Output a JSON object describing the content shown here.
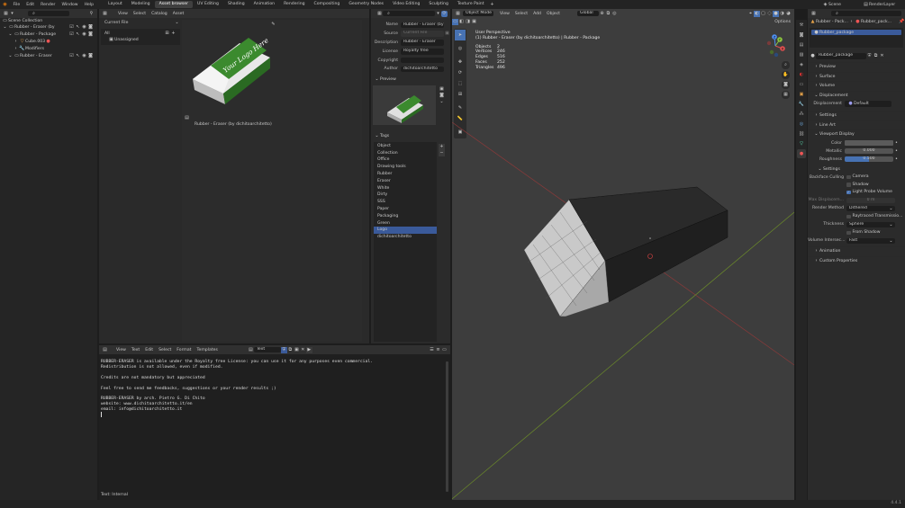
{
  "topbar": {
    "menus": [
      "File",
      "Edit",
      "Render",
      "Window",
      "Help"
    ],
    "workspaces": [
      {
        "label": "Layout"
      },
      {
        "label": "Modeling"
      },
      {
        "label": "Asset browser",
        "active": true
      },
      {
        "label": "UV Editing"
      },
      {
        "label": "Shading"
      },
      {
        "label": "Animation"
      },
      {
        "label": "Rendering"
      },
      {
        "label": "Compositing"
      },
      {
        "label": "Geometry Nodes"
      },
      {
        "label": "Video Editing"
      },
      {
        "label": "Sculpting"
      },
      {
        "label": "Texture Paint"
      }
    ],
    "scene": "Scene",
    "view_layer": "RenderLayer"
  },
  "outliner": {
    "search_placeholder": "",
    "root": "Scene Collection",
    "items": [
      {
        "label": "Rubber - Eraser (by",
        "depth": 0
      },
      {
        "label": "Rubber - Package",
        "depth": 1
      },
      {
        "label": "Cube.003",
        "depth": 2
      },
      {
        "label": "Modifiers",
        "depth": 2
      },
      {
        "label": "Rubber - Eraser",
        "depth": 1
      }
    ]
  },
  "asset_browser": {
    "menus": [
      "View",
      "Select",
      "Catalog",
      "Asset"
    ],
    "library": "Current File",
    "catalogs": [
      "All",
      "Unassigned"
    ],
    "asset_caption": "Rubber - Eraser (by dichitoarchitetto)",
    "thumb_text": "Your Logo Here"
  },
  "asset_meta": {
    "fields": [
      {
        "label": "Name",
        "value": "Rubber - Eraser (by"
      },
      {
        "label": "Source",
        "value": "Current File"
      },
      {
        "label": "Description",
        "value": "Rubber - Eraser"
      },
      {
        "label": "License",
        "value": "Royalty free"
      },
      {
        "label": "Copyright",
        "value": ""
      },
      {
        "label": "Author",
        "value": "dichitoarchitetto"
      }
    ],
    "preview_title": "Preview",
    "tags_title": "Tags",
    "tags": [
      "Object",
      "Collection",
      "Office",
      "Drawing tools",
      "Rubber",
      "Eraser",
      "White",
      "Dirty",
      "SSS",
      "Paper",
      "Packaging",
      "Green",
      "Logo",
      "dichitoarchitetto"
    ],
    "selected_tag": "Logo"
  },
  "text_editor": {
    "menus": [
      "View",
      "Text",
      "Edit",
      "Select",
      "Format",
      "Templates"
    ],
    "filename": "Text",
    "lines": [
      "RUBBER-ERASER is available under the Royalty free License: you can use it for any purposes even commercial.",
      "Redistribution is not allowed, even if modified.",
      "",
      "Credits are not mandatory but appreciated",
      "",
      "Feel free to send me feedbacks, suggestions or your render results ;)",
      "",
      "RUBBER-ERASER by arch. Pietro G. Di Chito",
      "website: www.dichitoarchitetto.it/en",
      "email: info@dichitoarchitetto.it"
    ],
    "status": "Text: Internal"
  },
  "viewport": {
    "mode": "Object Mode",
    "menus": [
      "View",
      "Select",
      "Add",
      "Object"
    ],
    "orientation": "Global",
    "options": "Options",
    "perspective": "User Perspective",
    "collection_path": "(1) Rubber - Eraser (by dichitoarchitetto) | Rubber - Package",
    "stats": [
      {
        "k": "Objects",
        "v": "2"
      },
      {
        "k": "Vertices",
        "v": "246"
      },
      {
        "k": "Edges",
        "v": "516"
      },
      {
        "k": "Faces",
        "v": "252"
      },
      {
        "k": "Triangles",
        "v": "496"
      }
    ],
    "axes": [
      "X",
      "Y",
      "Z"
    ]
  },
  "properties": {
    "breadcrumb_obj": "Rubber - Pack...",
    "breadcrumb_data": "Rubber_pack...",
    "data_list_item": "Rubber_package",
    "datablock": "Rubber_package",
    "sections": [
      "Preview",
      "Surface",
      "Volume"
    ],
    "displacement": {
      "title": "Displacement",
      "label": "Displacement",
      "value": "Default"
    },
    "settings": "Settings",
    "line_art": "Line Art",
    "viewport_display": {
      "title": "Viewport Display",
      "color_label": "Color",
      "metallic_label": "Metallic",
      "metallic": "0.000",
      "roughness_label": "Roughness",
      "roughness": "0.500",
      "roughness_frac": 0.5
    },
    "sub_settings": "Settings",
    "backface_label": "Backface Culling",
    "checks": [
      {
        "label": "Camera",
        "on": false
      },
      {
        "label": "Shadow",
        "on": false
      },
      {
        "label": "Light Probe Volume",
        "on": true
      }
    ],
    "max_disp_label": "Max Displacem...",
    "max_disp_val": "0 m",
    "render_method_label": "Render Method",
    "render_method": "Dithered",
    "raytraced": "Raytraced Transmissio...",
    "thickness_label": "Thickness",
    "thickness": "Sphere",
    "from_shadow": "From Shadow",
    "volume_label": "Volume Intersec...",
    "volume": "Fast",
    "bottom_sections": [
      "Animation",
      "Custom Properties"
    ]
  },
  "statusbar": {
    "version": "4.4.1"
  },
  "colors": {
    "accent": "#4772b3",
    "logo_green": "#3b8a2e"
  }
}
